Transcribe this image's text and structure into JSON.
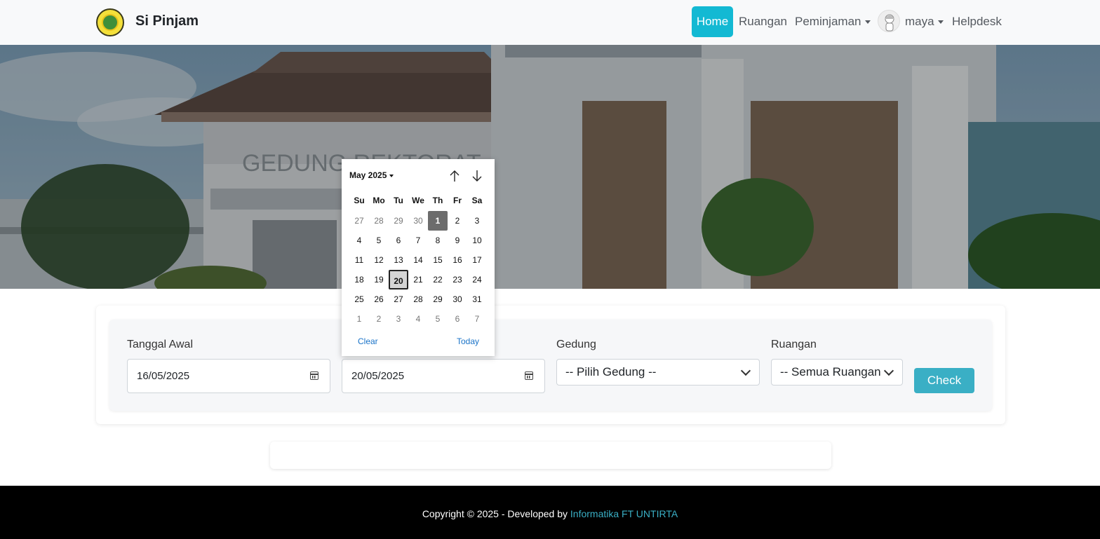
{
  "navbar": {
    "brand": "Si Pinjam",
    "items": [
      {
        "label": "Home",
        "active": true
      },
      {
        "label": "Ruangan"
      },
      {
        "label": "Peminjaman"
      },
      {
        "label": "maya"
      },
      {
        "label": "Helpdesk"
      }
    ],
    "accent": "#13b9d3"
  },
  "hero": {
    "building_sign": "GEDUNG REKTORAT"
  },
  "form": {
    "start_label": "Tanggal Awal",
    "start_value": "16/05/2025",
    "end_value": "20/05/2025",
    "building_label": "Gedung",
    "building_selected": "-- Pilih Gedung --",
    "room_label": "Ruangan",
    "room_selected": "-- Semua Ruangan --",
    "check_label": "Check",
    "button_color": "#3aafc5"
  },
  "datepicker": {
    "month_label": "May 2025",
    "weekdays": [
      "Su",
      "Mo",
      "Tu",
      "We",
      "Th",
      "Fr",
      "Sa"
    ],
    "weeks": [
      [
        "27",
        "28",
        "29",
        "30",
        "1",
        "2",
        "3"
      ],
      [
        "4",
        "5",
        "6",
        "7",
        "8",
        "9",
        "10"
      ],
      [
        "11",
        "12",
        "13",
        "14",
        "15",
        "16",
        "17"
      ],
      [
        "18",
        "19",
        "20",
        "21",
        "22",
        "23",
        "24"
      ],
      [
        "25",
        "26",
        "27",
        "28",
        "29",
        "30",
        "31"
      ],
      [
        "1",
        "2",
        "3",
        "4",
        "5",
        "6",
        "7"
      ]
    ],
    "highlighted_current": "1",
    "selected_day": "20",
    "clear_label": "Clear",
    "today_label": "Today"
  },
  "footer": {
    "text": "Copyright © 2025 - Developed by ",
    "link": "Informatika FT UNTIRTA"
  }
}
